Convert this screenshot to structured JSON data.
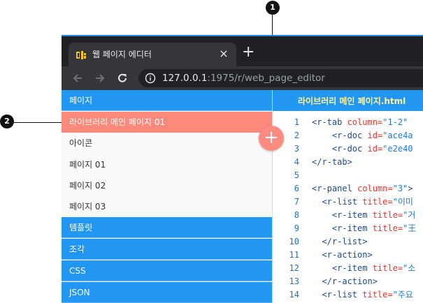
{
  "browser": {
    "tab_title": "웹 페이지 에디터",
    "tab_close": "×",
    "new_tab": "+",
    "url_host": "127.0.0.1",
    "url_rest": ":1975/r/web_page_editor"
  },
  "sidebar": {
    "section_pages": "페이지",
    "items": [
      "라이브러리 메인 페이지 01",
      "아이콘",
      "페이지 01",
      "페이지 02",
      "페이지 03"
    ],
    "section_templates": "템플릿",
    "section_fragments": "조각",
    "section_css": "CSS",
    "section_json": "JSON",
    "add_label": "+"
  },
  "editor": {
    "file_title": "라이브러리 메인 페이지.html",
    "lines": [
      {
        "num": "1",
        "indent": "",
        "tag": "<r-tab",
        "attr": " column=",
        "val": "\"1-2\"",
        "rest": ""
      },
      {
        "num": "2",
        "indent": "    ",
        "tag": "<r-doc",
        "attr": " id=",
        "val": "\"ace4a",
        "rest": ""
      },
      {
        "num": "3",
        "indent": "    ",
        "tag": "<r-doc",
        "attr": " id=",
        "val": "\"e2e40",
        "rest": ""
      },
      {
        "num": "4",
        "indent": "",
        "tag": "</r-tab>",
        "attr": "",
        "val": "",
        "rest": ""
      },
      {
        "num": "5",
        "indent": "",
        "tag": "",
        "attr": "",
        "val": "",
        "rest": ""
      },
      {
        "num": "6",
        "indent": "",
        "tag": "<r-panel",
        "attr": " column=",
        "val": "\"3\"",
        "rest": ">"
      },
      {
        "num": "7",
        "indent": "  ",
        "tag": "<r-list",
        "attr": " title=",
        "val": "\"이미",
        "rest": ""
      },
      {
        "num": "8",
        "indent": "    ",
        "tag": "<r-item",
        "attr": " title=",
        "val": "\"거",
        "rest": ""
      },
      {
        "num": "9",
        "indent": "    ",
        "tag": "<r-item",
        "attr": " title=",
        "val": "\"王",
        "rest": ""
      },
      {
        "num": "10",
        "indent": "  ",
        "tag": "</r-list>",
        "attr": "",
        "val": "",
        "rest": ""
      },
      {
        "num": "11",
        "indent": "  ",
        "tag": "<r-action>",
        "attr": "",
        "val": "",
        "rest": ""
      },
      {
        "num": "12",
        "indent": "    ",
        "tag": "<r-item",
        "attr": " title=",
        "val": "\"소",
        "rest": ""
      },
      {
        "num": "13",
        "indent": "  ",
        "tag": "</r-action>",
        "attr": "",
        "val": "",
        "rest": ""
      },
      {
        "num": "14",
        "indent": "  ",
        "tag": "<r-list",
        "attr": " title=",
        "val": "\"주요",
        "rest": ""
      }
    ]
  },
  "callouts": {
    "one": "1",
    "two": "2"
  },
  "colors": {
    "accent_blue": "#2196f3",
    "active_salmon": "#fb8a7d",
    "editor_title_yellow": "#fff59d"
  }
}
